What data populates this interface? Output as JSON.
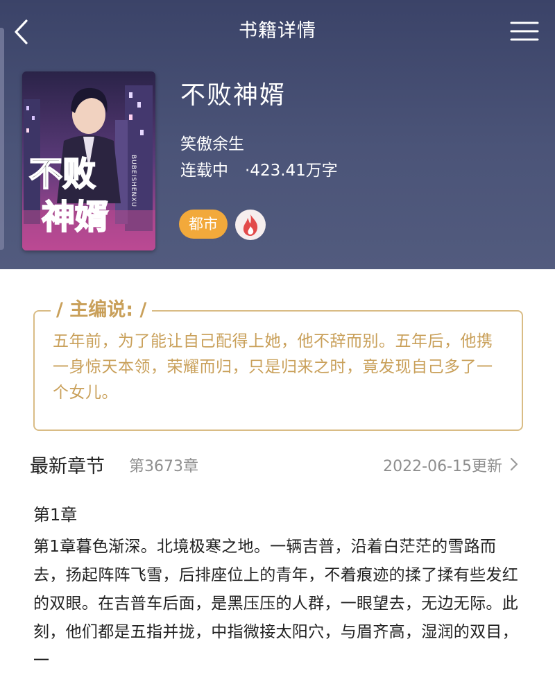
{
  "nav": {
    "title": "书籍详情",
    "back_icon": "chevron-left-icon",
    "menu_icon": "hamburger-menu-icon"
  },
  "book": {
    "cover_title": "不败神婿",
    "cover_pinyin": "BUBEISHENXU",
    "title": "不败神婿",
    "author": "笑傲余生",
    "status": "连载中",
    "word_count": "·423.41万字",
    "genre_tag": "都市",
    "hot_icon": "flame-icon"
  },
  "editor": {
    "label": "主编说:",
    "text": "五年前，为了能让自己配得上她，他不辞而别。五年后，他携一身惊天本领，荣耀而归，只是归来之时，竟发现自己多了一个女儿。"
  },
  "latest": {
    "label": "最新章节",
    "chapter": "第3673章",
    "updated": "2022-06-15更新"
  },
  "chapter": {
    "title": "第1章",
    "preview": "第1章暮色渐深。北境极寒之地。一辆吉普，沿着白茫茫的雪路而去，扬起阵阵飞雪，后排座位上的青年，不着痕迹的揉了揉有些发红的双眼。在吉普车后面，是黑压压的人群，一眼望去，无边无际。此刻，他们都是五指并拢，中指微接太阳穴，与眉齐高，湿润的双目，一"
  },
  "colors": {
    "header_bg": "#4b5478",
    "accent_gold": "#c9a05a",
    "tag_orange": "#f2a93b",
    "hot_red": "#e24a4a"
  }
}
